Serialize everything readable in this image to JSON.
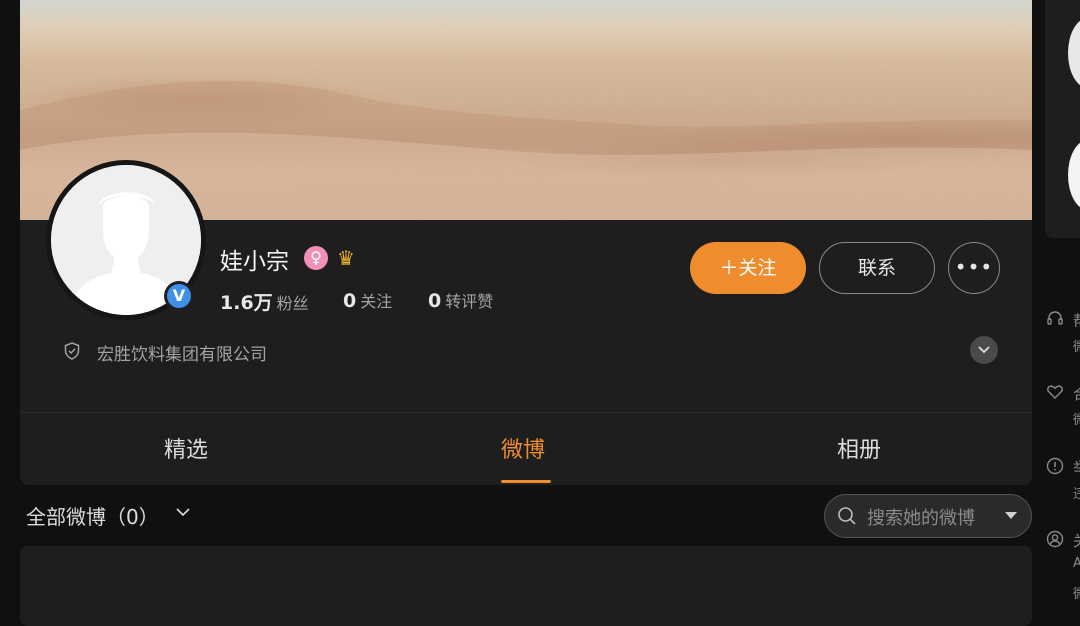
{
  "profile": {
    "name": "娃小宗",
    "verified_mark": "V",
    "gender_badge": "♀",
    "crown_badge": "♛",
    "stats": [
      {
        "value": "1.6万",
        "label": "粉丝"
      },
      {
        "value": "0",
        "label": "关注"
      },
      {
        "value": "0",
        "label": "转评赞"
      }
    ],
    "company": "宏胜饮料集团有限公司"
  },
  "actions": {
    "follow_label": "＋关注",
    "contact_label": "联系",
    "more_label": "•••"
  },
  "tabs": [
    {
      "label": "精选",
      "active": false
    },
    {
      "label": "微博",
      "active": true
    },
    {
      "label": "相册",
      "active": false
    }
  ],
  "feed": {
    "filter_label": "全部微博（0）",
    "search_placeholder": "搜索她的微博"
  },
  "sidebar": {
    "links": [
      {
        "icon": "headset-icon",
        "t1": "帮",
        "t2": "微"
      },
      {
        "icon": "heart-handshake-icon",
        "t1": "合",
        "t2": "微"
      },
      {
        "icon": "alert-icon",
        "t1": "举",
        "t2": "违"
      },
      {
        "icon": "user-circle-icon",
        "t1": "关",
        "t2": "A"
      }
    ],
    "extra_text": "微"
  },
  "colors": {
    "accent": "#ef8c2e",
    "background": "#101010",
    "card": "#1e1e1e",
    "verified": "#3e8fe6",
    "female_badge": "#f28fb8"
  }
}
